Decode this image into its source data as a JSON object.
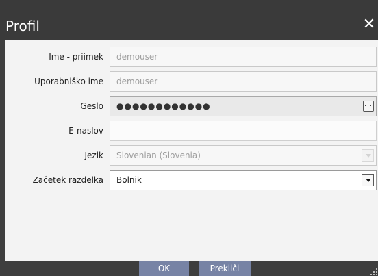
{
  "dialog": {
    "title": "Profil",
    "close_icon": "close-icon"
  },
  "form": {
    "full_name": {
      "label": "Ime - priimek",
      "value": "demouser"
    },
    "username": {
      "label": "Uporabniško ime",
      "value": "demouser"
    },
    "password": {
      "label": "Geslo",
      "value": "●●●●●●●●●●●●",
      "button_label": "..."
    },
    "email": {
      "label": "E-naslov",
      "value": ""
    },
    "language": {
      "label": "Jezik",
      "value": "Slovenian (Slovenia)"
    },
    "start_section": {
      "label": "Začetek razdelka",
      "value": "Bolnik"
    }
  },
  "buttons": {
    "ok": "OK",
    "cancel": "Prekliči"
  },
  "colors": {
    "titlebar": "#3a3a3a",
    "body": "#f3f3f3",
    "button": "#7783a5"
  }
}
